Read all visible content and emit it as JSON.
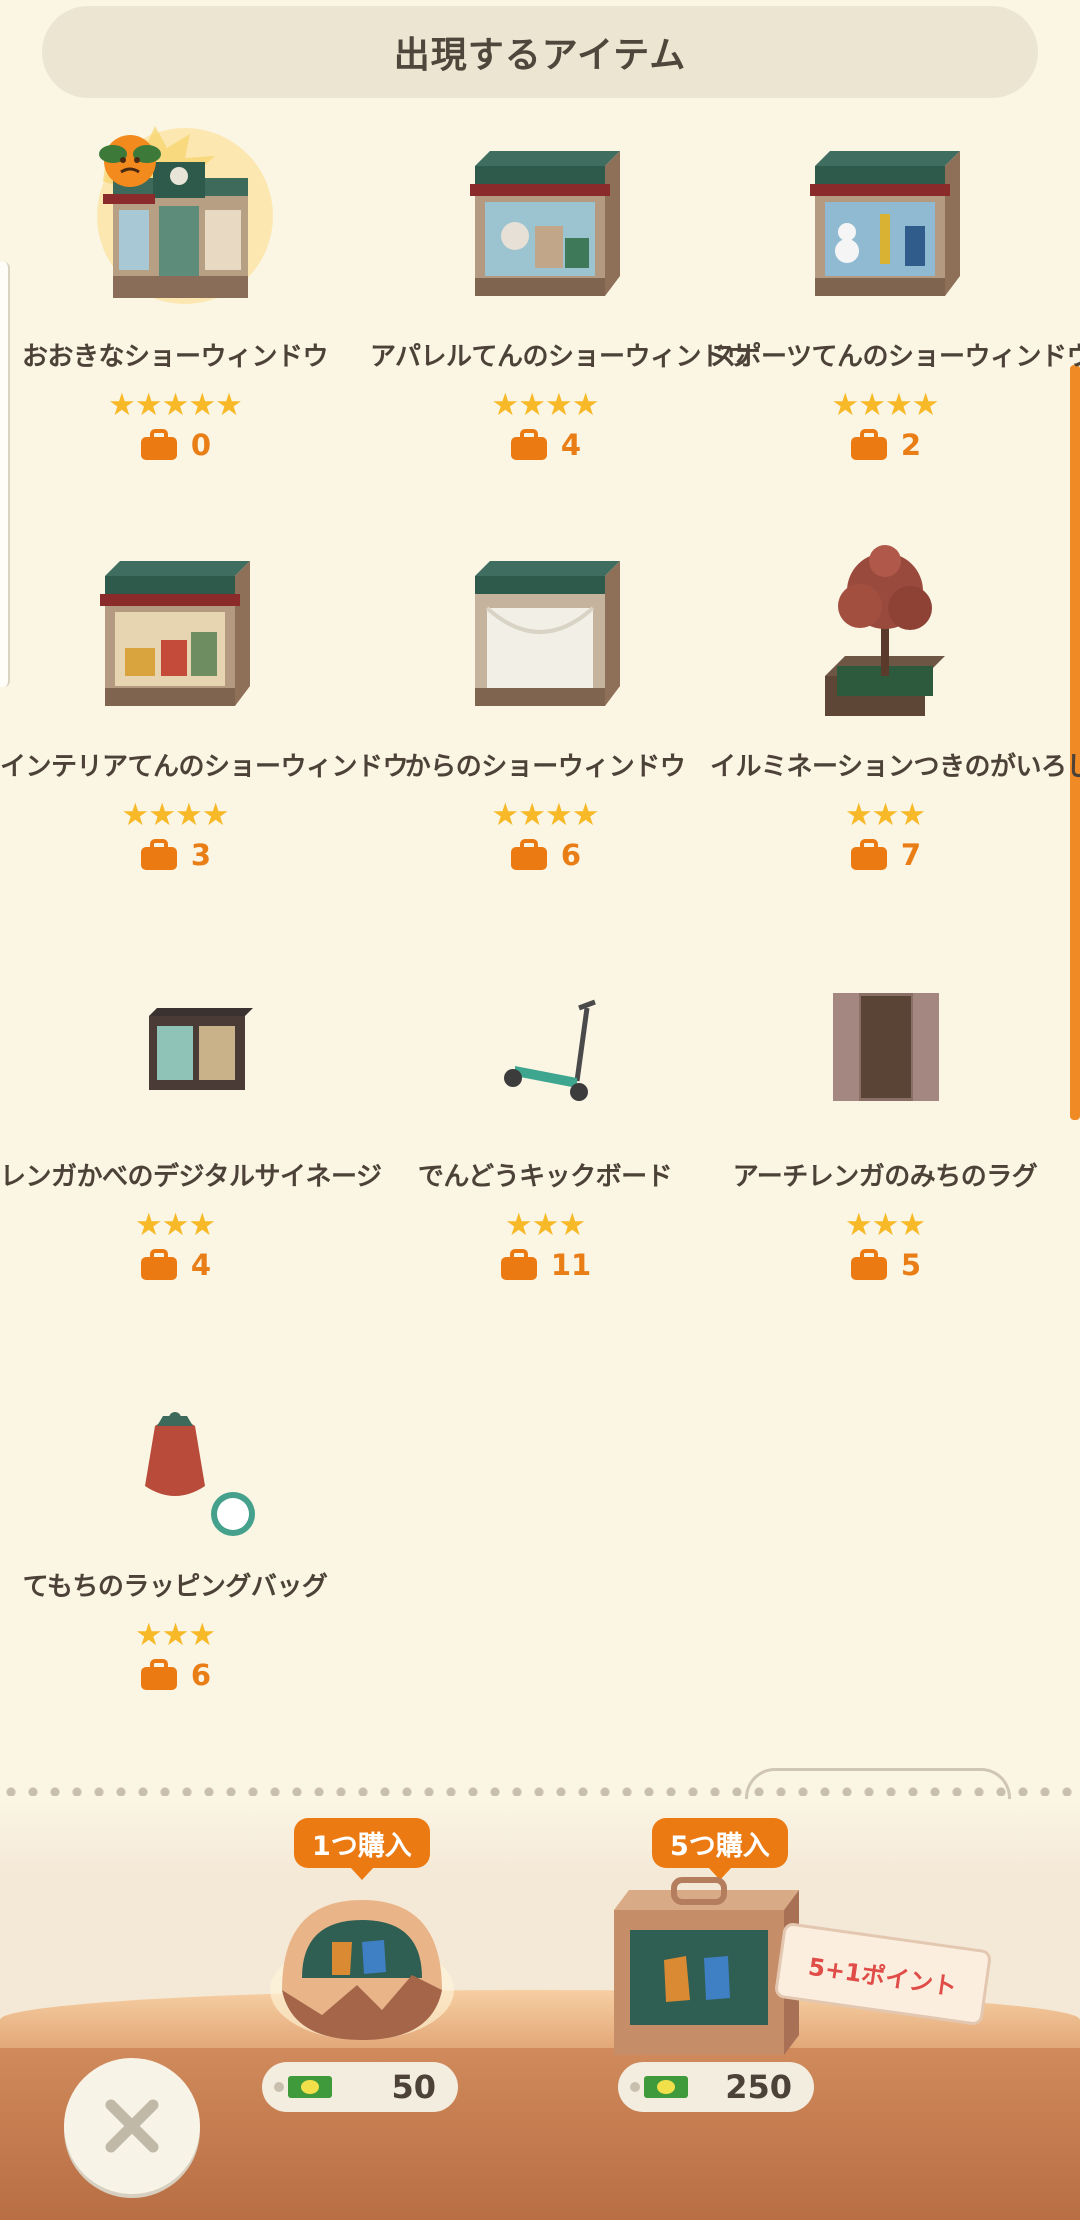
{
  "header": {
    "title": "出現するアイテム"
  },
  "items": [
    {
      "name": "おおきなショーウィンドウ",
      "stars": "★★★★★",
      "count": "0"
    },
    {
      "name": "アパレルてんのショーウィンドウ",
      "stars": "★★★★",
      "count": "4"
    },
    {
      "name": "スポーツてんのショーウィンドウ",
      "stars": "★★★★",
      "count": "2"
    },
    {
      "name": "インテリアてんのショーウィンドウ",
      "stars": "★★★★",
      "count": "3"
    },
    {
      "name": "からのショーウィンドウ",
      "stars": "★★★★",
      "count": "6"
    },
    {
      "name": "イルミネーションつきのがいろじゅ",
      "stars": "★★★",
      "count": "7"
    },
    {
      "name": "レンガかべのデジタルサイネージ",
      "stars": "★★★",
      "count": "4"
    },
    {
      "name": "でんどうキックボード",
      "stars": "★★★",
      "count": "11"
    },
    {
      "name": "アーチレンガのみちのラグ",
      "stars": "★★★",
      "count": "5"
    },
    {
      "name": "てもちのラッピングバッグ",
      "stars": "★★★",
      "count": "6"
    }
  ],
  "purchase": {
    "single": {
      "badge": "1つ購入",
      "price": "50"
    },
    "bundle": {
      "badge": "5つ購入",
      "price": "250",
      "tag": "5+1ポイント"
    }
  },
  "colors": {
    "accent": "#ec7a12",
    "star": "#f7b928",
    "background": "#fbf5e4",
    "tag_text": "#e04d48"
  }
}
